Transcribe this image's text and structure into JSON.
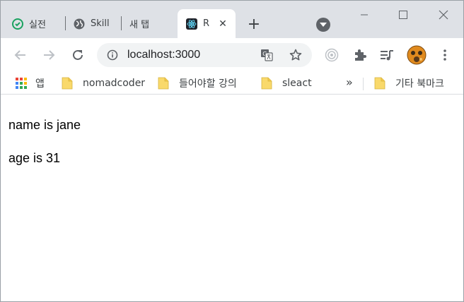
{
  "tabs": [
    {
      "title": "실전",
      "icon": "clock-check-icon"
    },
    {
      "title": "Skill",
      "icon": "globe-icon"
    },
    {
      "title": "새 탭",
      "icon": ""
    },
    {
      "title": "R",
      "icon": "react-icon",
      "active": true,
      "close": "✕"
    }
  ],
  "new_tab_label": "+",
  "window_controls": {
    "minimize": "—",
    "maximize": "☐",
    "close": "✕"
  },
  "address_bar": {
    "url": "localhost:3000"
  },
  "bookmarks": {
    "apps_label": "앱",
    "items": [
      {
        "label": "nomadcoder",
        "icon": "folder-icon"
      },
      {
        "label": "들어야할 강의",
        "icon": "folder-icon"
      },
      {
        "label": "sleact",
        "icon": "folder-icon"
      }
    ],
    "overflow": "»",
    "other_label": "기타 북마크"
  },
  "page": {
    "lines": [
      "name is jane",
      "age is 31"
    ]
  },
  "colors": {
    "tabstrip_bg": "#dee1e6",
    "omnibox_bg": "#f1f3f4",
    "folder": "#f9d96b",
    "text": "#3c4043"
  }
}
